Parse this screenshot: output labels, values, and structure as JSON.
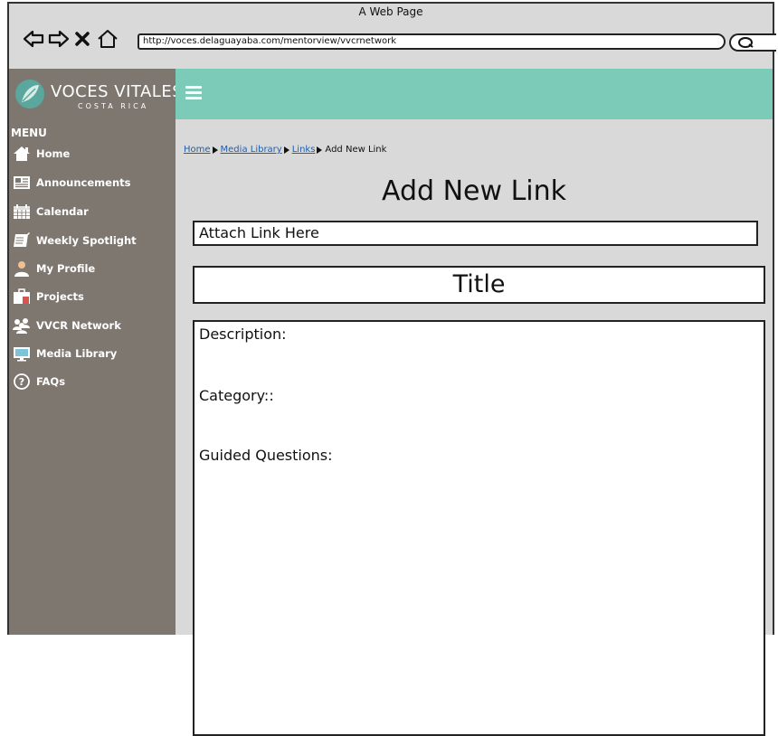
{
  "browser": {
    "window_title": "A Web Page",
    "url": "http://voces.delaguayaba.com/mentorview/vvcrnetwork"
  },
  "brand": {
    "name": "VOCES VITALES",
    "tagline": "COSTA RICA",
    "colors": {
      "sidebar": "#7e7770",
      "topbar": "#7ccbb8",
      "logo_teal": "#2fa8a0"
    }
  },
  "sidebar": {
    "menu_title": "MENU",
    "items": [
      {
        "label": "Home",
        "icon": "home-icon"
      },
      {
        "label": "Announcements",
        "icon": "newspaper-icon"
      },
      {
        "label": "Calendar",
        "icon": "calendar-icon"
      },
      {
        "label": "Weekly Spotlight",
        "icon": "notebook-icon"
      },
      {
        "label": "My Profile",
        "icon": "user-icon"
      },
      {
        "label": "Projects",
        "icon": "briefcase-icon"
      },
      {
        "label": "VVCR Network",
        "icon": "group-icon"
      },
      {
        "label": "Media Library",
        "icon": "monitor-icon"
      },
      {
        "label": "FAQs",
        "icon": "help-icon"
      }
    ]
  },
  "breadcrumb": {
    "items": [
      "Home",
      "Media Library",
      "Links"
    ],
    "current": "Add New Link"
  },
  "page": {
    "title": "Add New Link",
    "link_field": "Attach Link Here",
    "title_field": "Title",
    "description_label": "Description:",
    "category_label": "Category::",
    "questions_label": "Guided Questions:"
  }
}
